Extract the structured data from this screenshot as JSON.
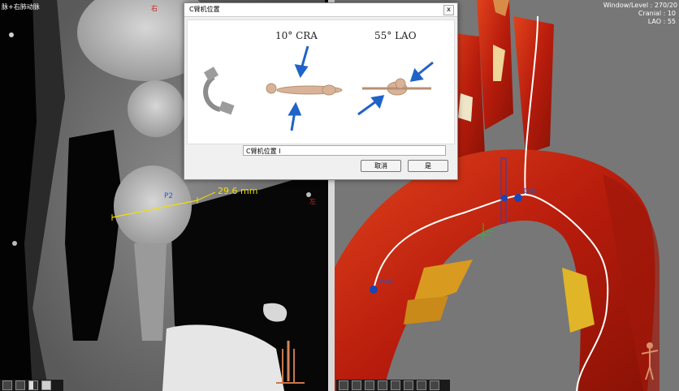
{
  "left_view": {
    "title": "脉+右肺动脉",
    "orientation_top": "右",
    "orientation_side": "左",
    "measurement_label": "P2",
    "measurement_value": "29.6 mm"
  },
  "right_view": {
    "window_level": "Window/Level : 270/20",
    "cranial": "Cranial : 10",
    "lao": "LAO : 55",
    "marker_prox": "Prox",
    "marker_distal": "Dist"
  },
  "dialog": {
    "title": "C臂机位置",
    "close_label": "x",
    "cra_angle": "10°  CRA",
    "lao_angle": "55°  LAO",
    "input_value": "C臂机位置 I",
    "cancel_label": "取消",
    "ok_label": "是"
  },
  "colors": {
    "arrow_blue": "#1f63c8",
    "measure_yellow": "#f0e000",
    "vessel_red": "#c4200e",
    "centerline": "#ffffff",
    "marker_blue": "#1946b4"
  },
  "icons": {
    "c_arm": "c-arm-icon",
    "orientation_figure": "body-orientation-figure",
    "crosshair": "crosshair-icon"
  }
}
